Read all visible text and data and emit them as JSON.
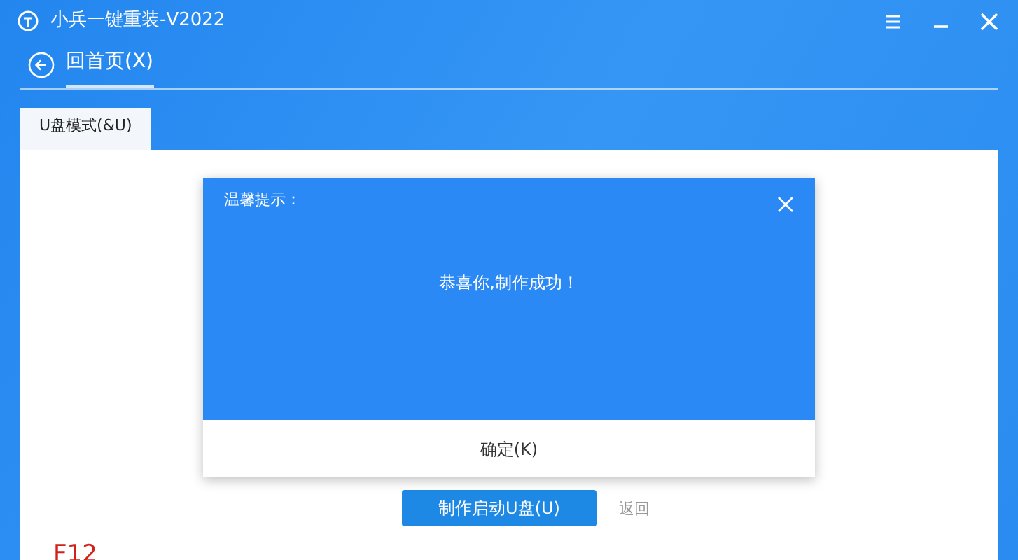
{
  "window": {
    "title": "小兵一键重装-V2022"
  },
  "nav": {
    "back_label": "回首页(X)"
  },
  "tabs": [
    {
      "label": "U盘模式(&U)",
      "selected": true
    }
  ],
  "content": {
    "make_button": "制作启动U盘(U)",
    "back_link": "返回",
    "hotkey": "F12"
  },
  "dialog": {
    "title": "温馨提示：",
    "message": "恭喜你,制作成功！",
    "ok_button": "确定(K)"
  }
}
